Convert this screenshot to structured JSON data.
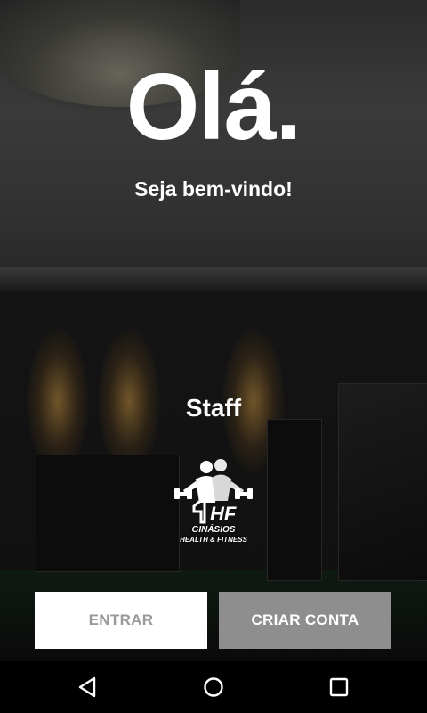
{
  "greeting": {
    "title": "Olá.",
    "subtitle": "Seja bem-vindo!"
  },
  "staff_label": "Staff",
  "logo": {
    "name": "gym-logo",
    "line1": "GINÁSIOS",
    "line2": "HEALTH & FITNESS",
    "monogram": "HF"
  },
  "buttons": {
    "login_label": "ENTRAR",
    "signup_label": "CRIAR CONTA"
  },
  "navbar": {
    "back_icon": "triangle-back-icon",
    "home_icon": "circle-home-icon",
    "recents_icon": "square-recents-icon"
  },
  "colors": {
    "login_bg": "#ffffff",
    "login_text": "#9a9a9a",
    "signup_bg": "#8e8e8e",
    "signup_text": "#ffffff",
    "navbar_bg": "#000000"
  }
}
